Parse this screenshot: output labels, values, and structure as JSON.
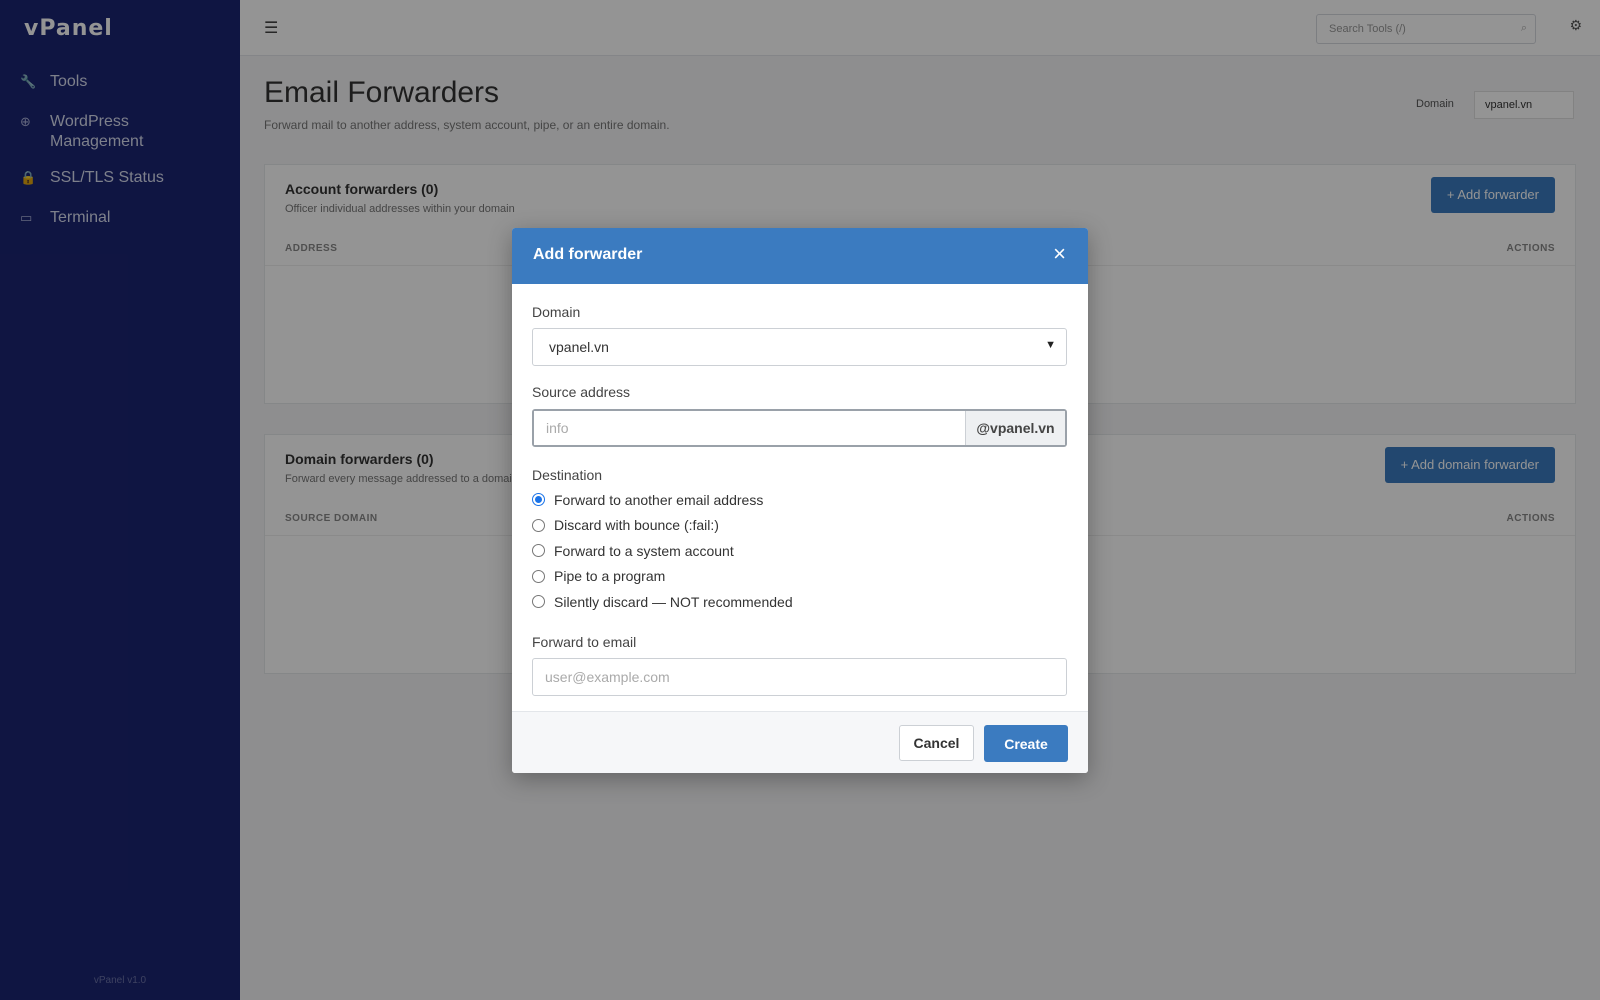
{
  "sidebar": {
    "logo": "vPanel",
    "items": [
      {
        "icon": "wrench-icon",
        "glyph": "🔧",
        "label": "Tools"
      },
      {
        "icon": "wordpress-icon",
        "glyph": "⊕",
        "label": "WordPress Management"
      },
      {
        "icon": "lock-icon",
        "glyph": "🔒",
        "label": "SSL/TLS Status"
      },
      {
        "icon": "terminal-icon",
        "glyph": "▭",
        "label": "Terminal"
      }
    ],
    "footer": "vPanel v1.0"
  },
  "topbar": {
    "search_placeholder": "Search Tools (/)"
  },
  "page": {
    "title": "Email Forwarders",
    "subtitle": "Forward mail to another address, system account, pipe, or an entire domain.",
    "domain_label": "Domain",
    "domain_value": "vpanel.vn"
  },
  "account_forwarders": {
    "title": "Account forwarders (0)",
    "subtitle": "Officer individual addresses within your domain",
    "button": "+ Add forwarder",
    "col_left": "ADDRESS",
    "col_right": "ACTIONS"
  },
  "domain_forwarders": {
    "title": "Domain forwarders (0)",
    "subtitle": "Forward every message addressed to a domain",
    "button": "+ Add domain forwarder",
    "col_left": "SOURCE DOMAIN",
    "col_right": "ACTIONS"
  },
  "modal": {
    "title": "Add forwarder",
    "close_glyph": "×",
    "domain_label": "Domain",
    "domain_value": "vpanel.vn",
    "source_label": "Source address",
    "source_placeholder": "info",
    "source_suffix": "@vpanel.vn",
    "destination_label": "Destination",
    "destinations": [
      {
        "label": "Forward to another email address",
        "checked": true
      },
      {
        "label": "Discard with bounce (:fail:)",
        "checked": false
      },
      {
        "label": "Forward to a system account",
        "checked": false
      },
      {
        "label": "Pipe to a program",
        "checked": false
      },
      {
        "label": "Silently discard — NOT recommended",
        "checked": false
      }
    ],
    "forward_label": "Forward to email",
    "forward_placeholder": "user@example.com",
    "cancel_label": "Cancel",
    "create_label": "Create"
  },
  "colors": {
    "sidebar_bg": "#1b2572",
    "accent": "#3b7bc0",
    "radio_checked": "#1a73e8"
  }
}
